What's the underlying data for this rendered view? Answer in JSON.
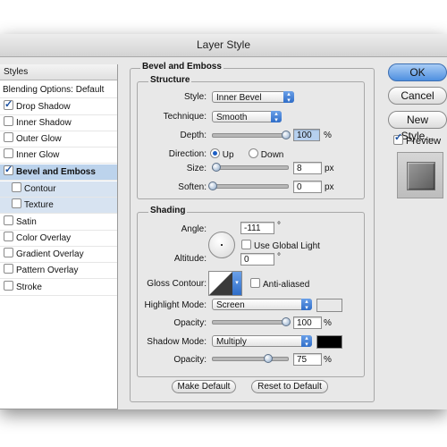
{
  "window": {
    "title": "Layer Style"
  },
  "styles_list": {
    "header": "Styles",
    "blending": "Blending Options: Default",
    "items": [
      {
        "label": "Drop Shadow",
        "checked": true
      },
      {
        "label": "Inner Shadow",
        "checked": false
      },
      {
        "label": "Outer Glow",
        "checked": false
      },
      {
        "label": "Inner Glow",
        "checked": false
      },
      {
        "label": "Bevel and Emboss",
        "checked": true
      },
      {
        "label": "Contour",
        "checked": false
      },
      {
        "label": "Texture",
        "checked": false
      },
      {
        "label": "Satin",
        "checked": false
      },
      {
        "label": "Color Overlay",
        "checked": false
      },
      {
        "label": "Gradient Overlay",
        "checked": false
      },
      {
        "label": "Pattern Overlay",
        "checked": false
      },
      {
        "label": "Stroke",
        "checked": false
      }
    ]
  },
  "bevel": {
    "section_title": "Bevel and Emboss",
    "structure_title": "Structure",
    "style_label": "Style:",
    "style_value": "Inner Bevel",
    "technique_label": "Technique:",
    "technique_value": "Smooth",
    "depth_label": "Depth:",
    "depth_value": "100",
    "depth_unit": "%",
    "direction_label": "Direction:",
    "direction_up": "Up",
    "direction_down": "Down",
    "size_label": "Size:",
    "size_value": "8",
    "size_unit": "px",
    "soften_label": "Soften:",
    "soften_value": "0",
    "soften_unit": "px"
  },
  "shading": {
    "title": "Shading",
    "angle_label": "Angle:",
    "angle_value": "-111",
    "angle_unit": "°",
    "global_light": "Use Global Light",
    "altitude_label": "Altitude:",
    "altitude_value": "0",
    "altitude_unit": "°",
    "gloss_label": "Gloss Contour:",
    "anti_aliased": "Anti-aliased",
    "highlight_mode_label": "Highlight Mode:",
    "highlight_mode_value": "Screen",
    "highlight_color": "#ffffff",
    "opacity_label": "Opacity:",
    "highlight_opacity": "100",
    "shadow_mode_label": "Shadow Mode:",
    "shadow_mode_value": "Multiply",
    "shadow_color": "#000000",
    "shadow_opacity": "75",
    "pct": "%"
  },
  "buttons": {
    "make_default": "Make Default",
    "reset_default": "Reset to Default",
    "ok": "OK",
    "cancel": "Cancel",
    "new_style": "New Style...",
    "preview": "Preview"
  }
}
